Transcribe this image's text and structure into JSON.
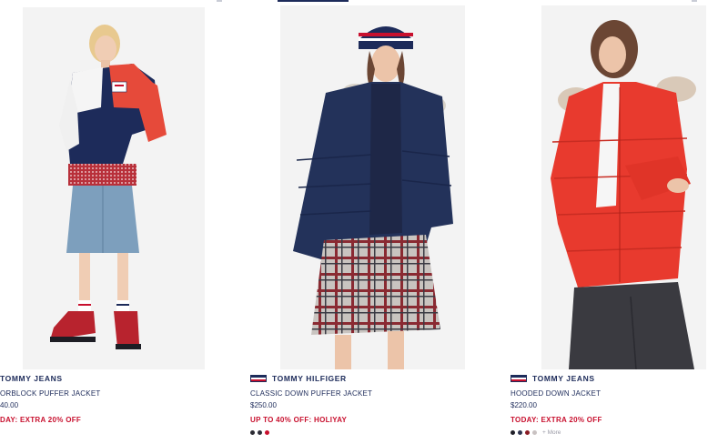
{
  "products": [
    {
      "brand": "TOMMY JEANS",
      "name": "ORBLOCK PUFFER JACKET",
      "price": "40.00",
      "promo": "DAY: EXTRA 20% OFF",
      "swatches": [],
      "image_alt": "Model in navy, white and red colour-block puffer jacket with denim skirt and red hiking boots"
    },
    {
      "brand": "TOMMY HILFIGER",
      "name": "CLASSIC DOWN PUFFER JACKET",
      "price": "$250.00",
      "promo": "UP TO 40% OFF: HOLIYAY",
      "swatches": [
        "#2b2b33",
        "#2e2e3a",
        "#c8102e"
      ],
      "image_alt": "Model in navy down puffer jacket with plaid skirt and striped beanie"
    },
    {
      "brand": "TOMMY JEANS",
      "name": "HOODED DOWN JACKET",
      "price": "$220.00",
      "promo": "TODAY: EXTRA 20% OFF",
      "swatches": [
        "#1f1f28",
        "#2f3550",
        "#8a1c24",
        "#c9c2c2"
      ],
      "more": "+ More",
      "image_alt": "Model in red hooded down jacket with faux-fur trim and black jeans"
    }
  ],
  "colors": {
    "navy": "#1d2b5a",
    "red": "#c8102e",
    "white": "#ffffff"
  }
}
